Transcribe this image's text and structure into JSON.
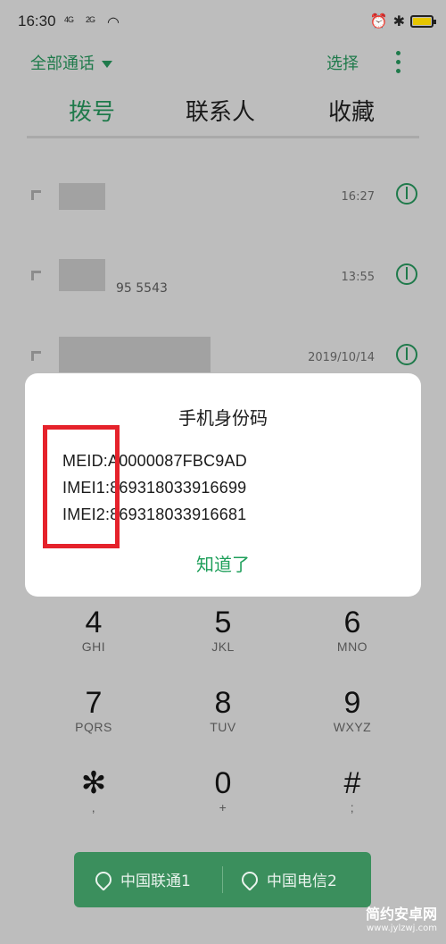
{
  "status_bar": {
    "time": "16:30",
    "signal1": "4G",
    "signal2": "2G"
  },
  "topbar": {
    "filter_label": "全部通话",
    "select_label": "选择"
  },
  "tabs": [
    {
      "label": "拨号",
      "active": true
    },
    {
      "label": "联系人",
      "active": false
    },
    {
      "label": "收藏",
      "active": false
    }
  ],
  "call_log": [
    {
      "number_partial": "",
      "time": "16:27"
    },
    {
      "number_partial": "95 5543",
      "time": "13:55"
    },
    {
      "number_partial": "",
      "time": "2019/10/14"
    }
  ],
  "dialog": {
    "title": "手机身份码",
    "meid": "MEID:A0000087FBC9AD",
    "imei1": "IMEI1:869318033916699",
    "imei2": "IMEI2:869318033916681",
    "ok_label": "知道了"
  },
  "keypad": [
    {
      "digit": "4",
      "letters": "GHI"
    },
    {
      "digit": "5",
      "letters": "JKL"
    },
    {
      "digit": "6",
      "letters": "MNO"
    },
    {
      "digit": "7",
      "letters": "PQRS"
    },
    {
      "digit": "8",
      "letters": "TUV"
    },
    {
      "digit": "9",
      "letters": "WXYZ"
    },
    {
      "digit": "✻",
      "letters": ","
    },
    {
      "digit": "0",
      "letters": "+"
    },
    {
      "digit": "#",
      "letters": ";"
    }
  ],
  "dial_bar": {
    "sim1_label": "中国联通1",
    "sim2_label": "中国电信2"
  },
  "watermark": {
    "brand": "简约安卓网",
    "url": "www.jylzwj.com"
  },
  "colors": {
    "accent": "#1f7a4b",
    "dialog_button": "#1e9f5a",
    "highlight_box": "#e5222b"
  }
}
